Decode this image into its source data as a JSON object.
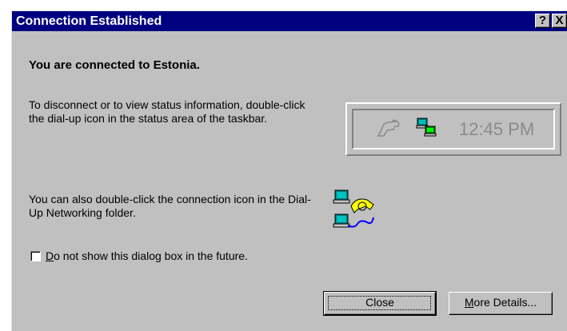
{
  "window": {
    "title": "Connection Established",
    "help_symbol": "?",
    "close_symbol": "X"
  },
  "heading": "You are connected to Estonia.",
  "paragraph1": "To disconnect or to view status information, double-click the dial-up icon in the status area of the taskbar.",
  "paragraph2": "You can also double-click the connection icon in the Dial-Up Networking folder.",
  "status_area": {
    "clock": "12:45 PM",
    "icons": [
      "phone-handset-icon",
      "dialup-network-icon"
    ]
  },
  "folder_icon": "dialup-networking-icon",
  "checkbox": {
    "label_first": "D",
    "label_rest": "o not show this dialog box in the future.",
    "checked": false
  },
  "buttons": {
    "close": "Close",
    "more_details_first": "M",
    "more_details_rest": "ore Details..."
  },
  "colors": {
    "titlebar": "#000080",
    "face": "#c0c0c0"
  }
}
